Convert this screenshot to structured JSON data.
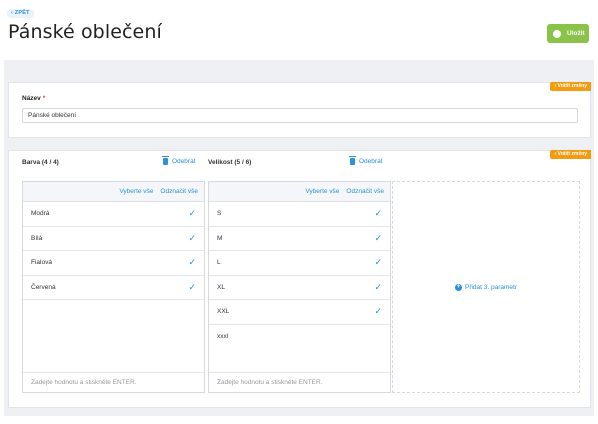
{
  "header": {
    "back_label": "‹ ZPĚT",
    "title": "Pánské oblečení",
    "save_label": "Uložit"
  },
  "name_section": {
    "revert_label": "‹ Vrátit změny",
    "label": "Název",
    "required_mark": "*",
    "value": "Pánské oblečení"
  },
  "params_section": {
    "revert_label": "‹ Vrátit změny",
    "color": {
      "title": "Barva (4 / 4)",
      "remove_label": "Odebrat",
      "select_all": "Vyberte vše",
      "deselect_all": "Odznačit vše",
      "items": [
        {
          "label": "Modrá",
          "check": "✓"
        },
        {
          "label": "Bílá",
          "check": "✓"
        },
        {
          "label": "Fialová",
          "check": "✓"
        },
        {
          "label": "Červená",
          "check": "✓"
        }
      ],
      "input_placeholder": "Zadejte hodnotu a stiskněte ENTER."
    },
    "size": {
      "title": "Velikost (5 / 6)",
      "remove_label": "Odebrat",
      "select_all": "Vyberte vše",
      "deselect_all": "Odznačit vše",
      "items": [
        {
          "label": "S",
          "check": "✓"
        },
        {
          "label": "M",
          "check": "✓"
        },
        {
          "label": "L",
          "check": "✓"
        },
        {
          "label": "XL",
          "check": "✓"
        },
        {
          "label": "XXL",
          "check": "✓"
        },
        {
          "label": "xxxl",
          "check": ""
        }
      ],
      "input_placeholder": "Zadejte hodnotu a stiskněte ENTER."
    },
    "add_third": {
      "plus": "+",
      "label": "Přidat 3. parametr"
    }
  },
  "colors": {
    "accent": "#2b93d8",
    "save_green": "#8bc34a",
    "revert_orange": "#f39c12",
    "required_red": "#e53935"
  }
}
